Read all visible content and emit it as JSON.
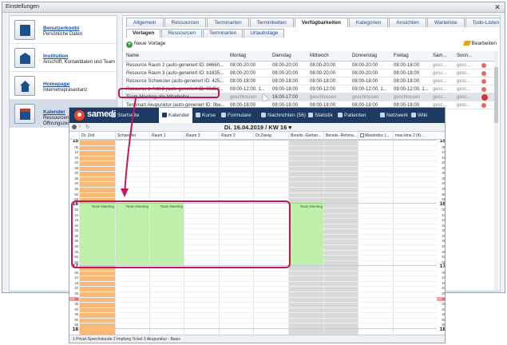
{
  "window": {
    "title": "Einstellungen",
    "close": "✕"
  },
  "left_nav": [
    {
      "title": "Benutzerkonto",
      "sub": "Persönliche Daten",
      "sub2": "",
      "icon": "id-card-icon"
    },
    {
      "title": "Institution",
      "sub": "Anschrift, Kontaktdaten und Team",
      "sub2": "",
      "icon": "building-icon"
    },
    {
      "title": "Homepage",
      "sub": "Internetrepräsentanz",
      "sub2": "",
      "icon": "home-icon"
    },
    {
      "title": "Kalender",
      "sub": "Ressourcen, Te",
      "sub2": "Öffnungszeiten",
      "icon": "calendar-icon",
      "selected": true
    }
  ],
  "tabs_main": [
    "Allgemein",
    "Ressourcen",
    "Terminarten",
    "Terminketten",
    "Verfügbarkeiten",
    "Kategorien",
    "Ansichten",
    "Warteliste",
    "Todo-Listen"
  ],
  "tabs_main_active": 4,
  "tabs_sub": [
    "Vorlagen",
    "Ressourcen",
    "Terminarten",
    "Urlaubstage"
  ],
  "tabs_sub_active": 0,
  "toolbar": {
    "new_label": "Neue Vorlage",
    "edit_label": "Bearbeiten"
  },
  "grid": {
    "headers": [
      "Name",
      "Montag",
      "Dienstag",
      "Mittwoch",
      "Donnerstag",
      "Freitag",
      "Sam...",
      "Sonn..."
    ],
    "rows": [
      [
        "Resource Raum 2 (auto-generiert ID: b6660...",
        "08:00-20:00",
        "08:00-20:00",
        "08:00-20:00",
        "08:00-20:00",
        "08:00-18:00",
        "gesc...",
        "gesc..."
      ],
      [
        "Resource Raum 3 (auto-generiert ID: b1835...",
        "08:00-20:00",
        "08:00-20:00",
        "08:00-20:00",
        "08:00-20:00",
        "08:00-18:00",
        "gesc...",
        "gesc..."
      ],
      [
        "Resource Schwester (auto-generiert ID: 425...",
        "08:00-18:00",
        "08:00-18:00",
        "08:00-18:00",
        "08:00-18:00",
        "08:00-18:00",
        "gesc...",
        "gesc..."
      ],
      [
        "Resource z-Arzt 2 (auto-generiert ID: 00d6d...",
        "09:00-12:00, 1...",
        "09:00-18:00",
        "09:00-12:00",
        "09:00-12:00, 1...",
        "09:00-12:00, 1...",
        "gesc...",
        "gesc..."
      ],
      [
        "Team-Meeting alle Mitarbeiter",
        "geschlossen",
        "16:00-17:00",
        "geschlossen",
        "geschlossen",
        "geschlossen",
        "gesc...",
        "gesc..."
      ],
      [
        "Terminart Akupunktur (auto-generiert ID: 0be...",
        "08:00-18:00",
        "08:00-18:00",
        "08:00-18:00",
        "08:00-18:00",
        "08:00-18:00",
        "gesc...",
        "gesc..."
      ]
    ],
    "highlight_row": 4
  },
  "samedi": {
    "brand": "samedi",
    "nav": [
      {
        "label": "Startseite",
        "icon": "house-icon"
      },
      {
        "label": "Kalender",
        "icon": "calendar-icon",
        "active": true
      },
      {
        "label": "Kurse",
        "icon": "people-icon"
      },
      {
        "label": "Formulare",
        "icon": "form-icon"
      },
      {
        "label": "Nachrichten (56)",
        "icon": "mail-icon"
      },
      {
        "label": "Statistik",
        "icon": "chart-icon"
      },
      {
        "label": "Patienten",
        "icon": "patient-icon"
      },
      {
        "label": "Netzwerk",
        "icon": "network-icon"
      },
      {
        "label": "Wiki",
        "icon": "book-icon"
      }
    ],
    "date_label": "Di. 16.04.2019 / KW 16 ▾",
    "columns": [
      "Dr. Zeit",
      "Schwester",
      "Raum 1",
      "Raum 3",
      "Raum 2",
      "Dr.Zweig",
      "Bereits.-Gerber...",
      "Bereits.-Rehma...",
      "Masterdoc (...",
      "max-time 2 (Ki..."
    ],
    "time_labels": [
      "15",
      "05",
      "10",
      "15",
      "20",
      "25",
      "30",
      "35",
      "40",
      "45",
      "50",
      "55",
      "16",
      "05",
      "10",
      "15",
      "20",
      "25",
      "30",
      "35",
      "40",
      "45",
      "50",
      "55",
      "17",
      "05",
      "10",
      "15",
      "20",
      "25",
      "30",
      "35",
      "40",
      "45",
      "50",
      "55",
      "18"
    ],
    "now_label": "30",
    "appointment_label": "Team-Meeting",
    "footer": "1 Privat-Sprechstunde  2 Impfung Ticket  3 Akupunktur - Basis"
  },
  "colors": {
    "accent": "#c2185b",
    "nav_bg": "#1d3a63",
    "appt": "#bff0ac",
    "orange": "#f8b878",
    "gray": "#d9d9d9"
  }
}
